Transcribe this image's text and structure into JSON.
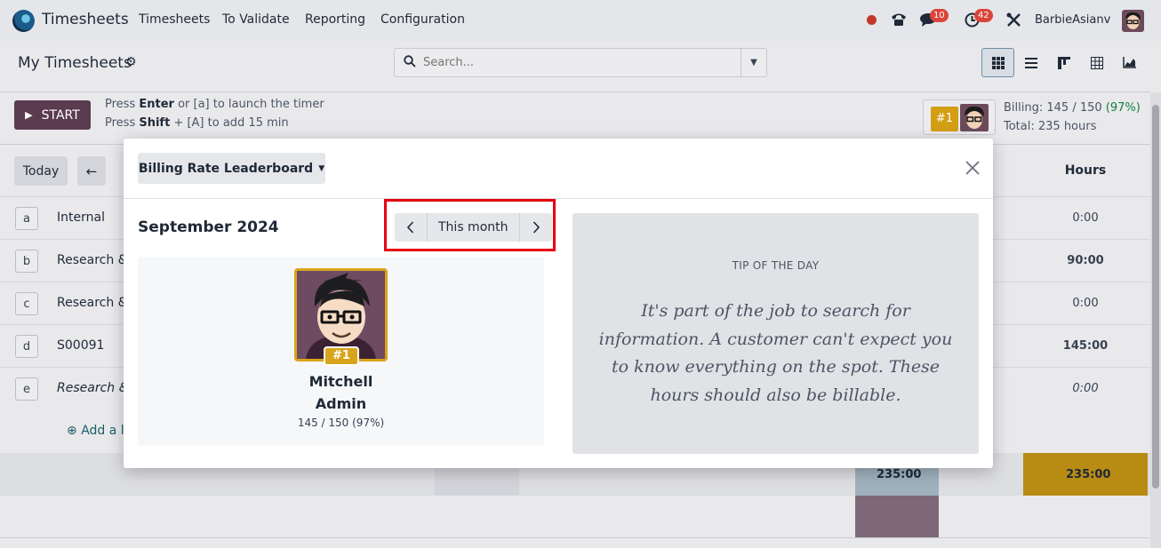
{
  "navbar": {
    "app_name": "Timesheets",
    "menu": [
      "Timesheets",
      "To Validate",
      "Reporting",
      "Configuration"
    ],
    "messages_badge": "10",
    "activities_badge": "42",
    "user_name": "BarbieAsianv"
  },
  "control_panel": {
    "title": "My Timesheets",
    "search_placeholder": "Search..."
  },
  "timer": {
    "start_label": "START",
    "hint_line1_pre": "Press ",
    "hint_line1_key": "Enter",
    "hint_line1_post": " or [a] to launch the timer",
    "hint_line2_pre": "Press ",
    "hint_line2_key": "Shift",
    "hint_line2_post": " + [A] to add 15 min"
  },
  "billing": {
    "rank": "#1",
    "line1_pre": "Billing: 145 / 150 ",
    "line1_pct": "(97%)",
    "line2": "Total: 235 hours"
  },
  "grid": {
    "today_label": "Today",
    "hours_header": "Hours",
    "rows": [
      {
        "key": "a",
        "label": "Internal",
        "hours": "0:00"
      },
      {
        "key": "b",
        "label": "Research &",
        "hours": "90:00"
      },
      {
        "key": "c",
        "label": "Research &",
        "hours": "0:00"
      },
      {
        "key": "d",
        "label": "S00091",
        "hours": "145:00"
      },
      {
        "key": "e",
        "label": "Research &",
        "hours": "0:00"
      }
    ],
    "add_line_label": "Add a l",
    "total_mid": "235:00",
    "total_right": "235:00"
  },
  "modal": {
    "dropdown_label": "Billing Rate Leaderboard",
    "month_title": "September 2024",
    "pager_label": "This month",
    "leader": {
      "rank": "#1",
      "name_line1": "Mitchell",
      "name_line2": "Admin",
      "score": "145 / 150 (97%)"
    },
    "tip": {
      "title": "TIP OF THE DAY",
      "text": "It's part of the job to search for information. A customer can't expect you to know everything on the spot. These hours should also be billable."
    }
  },
  "colors": {
    "highlight": "#e60012",
    "gold": "#d8a51a",
    "primary": "#5b3b4f"
  }
}
